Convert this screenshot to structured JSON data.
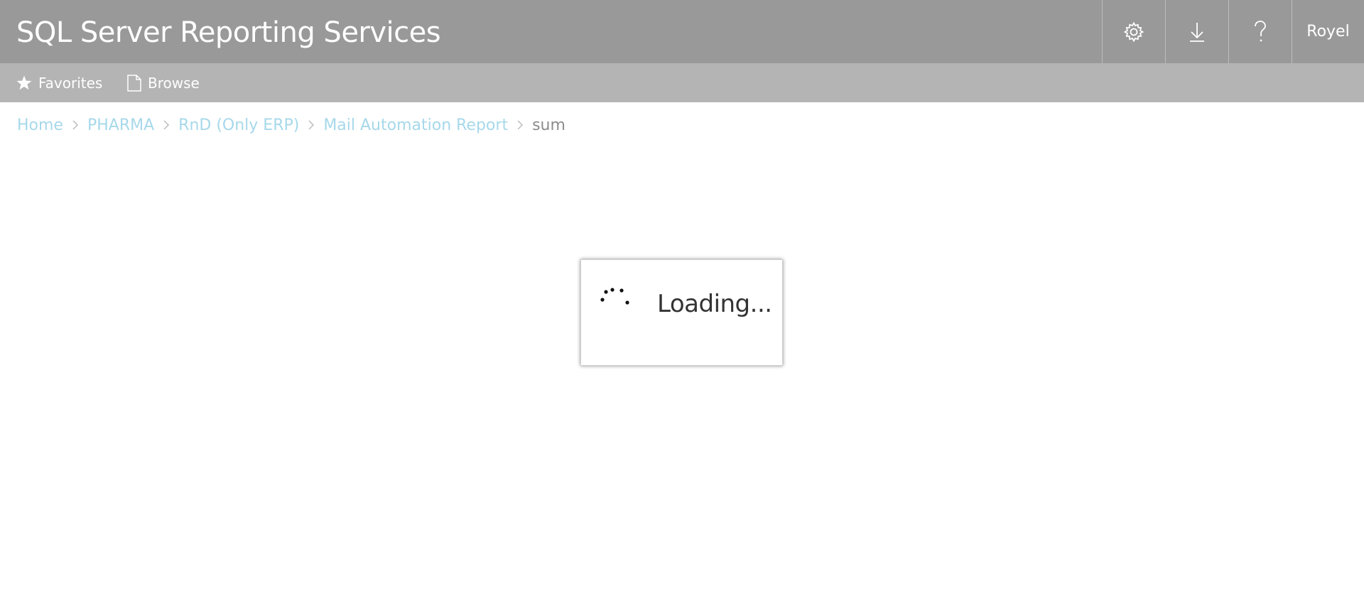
{
  "header": {
    "title": "SQL Server Reporting Services",
    "settings_icon": "gear-icon",
    "download_icon": "download-icon",
    "help_icon": "help-icon",
    "user_name": "Royel"
  },
  "nav": {
    "favorites_label": "Favorites",
    "favorites_icon": "star-icon",
    "browse_label": "Browse",
    "browse_icon": "document-icon"
  },
  "breadcrumb": {
    "items": [
      {
        "label": "Home",
        "current": false
      },
      {
        "label": "PHARMA",
        "current": false
      },
      {
        "label": "RnD (Only ERP)",
        "current": false
      },
      {
        "label": "Mail Automation Report",
        "current": false
      },
      {
        "label": "sum",
        "current": true
      }
    ],
    "separator_icon": "chevron-right-icon"
  },
  "loading": {
    "text": "Loading...",
    "icon": "spinner-icon"
  },
  "colors": {
    "topbar": "#999999",
    "navbar": "#b4b4b4",
    "link": "#a6d8ea",
    "current_crumb": "#8c8c8c"
  }
}
